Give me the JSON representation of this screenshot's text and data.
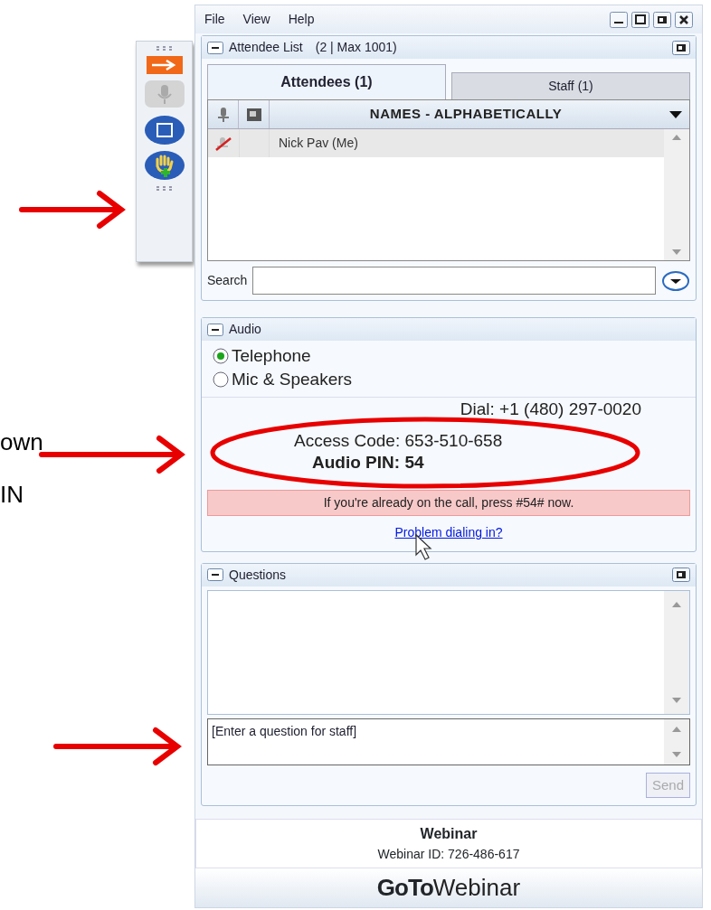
{
  "slide_text": [
    "own",
    "IN"
  ],
  "toolbar": [
    {
      "kind": "grip"
    },
    {
      "kind": "arrow",
      "disabled": false
    },
    {
      "kind": "mic",
      "disabled": true
    },
    {
      "kind": "screen",
      "disabled": false
    },
    {
      "kind": "hand",
      "disabled": false
    },
    {
      "kind": "grip"
    }
  ],
  "menu": [
    "File",
    "View",
    "Help"
  ],
  "attendee_panel": {
    "title": "Attendee List",
    "count": "(2 | Max 1001)",
    "tabs": [
      {
        "label": "Attendees (1)",
        "selected": true
      },
      {
        "label": "Staff (1)",
        "selected": false
      }
    ],
    "column": "NAMES - ALPHABETICALLY",
    "rows": [
      {
        "name": "Nick Pav (Me)",
        "muted": true
      }
    ],
    "search_label": "Search"
  },
  "audio_panel": {
    "title": "Audio",
    "options": [
      {
        "label": "Telephone",
        "selected": true
      },
      {
        "label": "Mic & Speakers",
        "selected": false
      }
    ],
    "dial": "Dial: +1 (480) 297-0020",
    "access_code": "Access Code: 653-510-658",
    "pin": "Audio PIN: 54",
    "notice": "If you're already on the call, press #54# now.",
    "link": "Problem dialing in?"
  },
  "questions_panel": {
    "title": "Questions",
    "placeholder": "[Enter a question for staff]",
    "send": {
      "label": "Send",
      "disabled": true
    }
  },
  "footer": {
    "title": "Webinar",
    "webinar_id": "Webinar ID: 726-486-617",
    "logo_bold": "GoTo",
    "logo_light": "Webinar"
  }
}
